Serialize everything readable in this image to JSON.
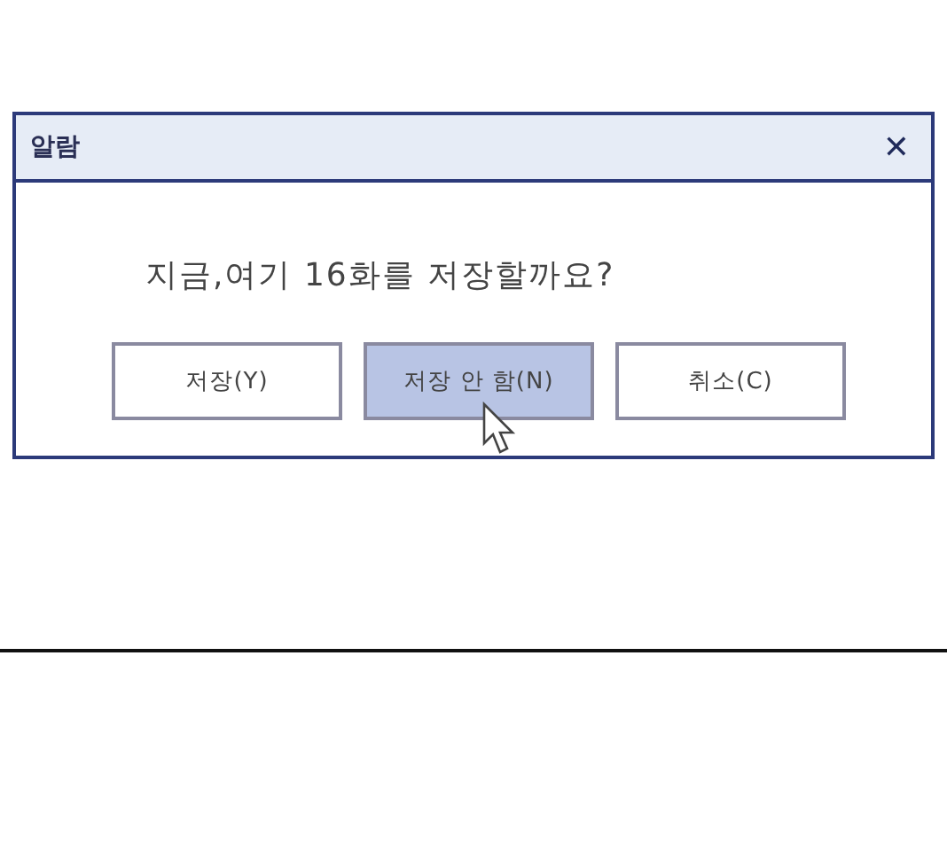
{
  "dialog": {
    "title": "알람",
    "close": "✕",
    "message": "지금,여기 16화를 저장할까요?",
    "buttons": [
      {
        "label": "저장(Y)",
        "selected": false
      },
      {
        "label": "저장 안 함(N)",
        "selected": true
      },
      {
        "label": "취소(C)",
        "selected": false
      }
    ]
  }
}
